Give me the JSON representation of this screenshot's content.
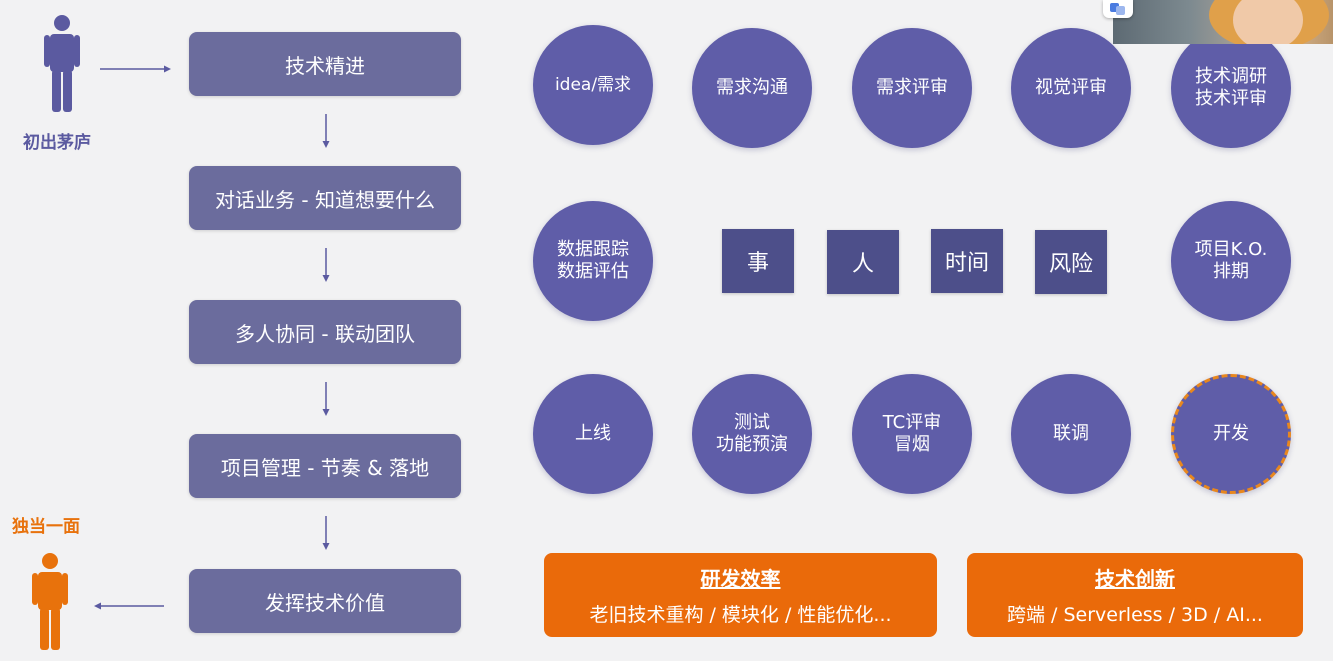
{
  "flow": {
    "steps": [
      "技术精进",
      "对话业务 - 知道想要什么",
      "多人协同 - 联动团队",
      "项目管理 - 节奏 & 落地",
      "发挥技术价值"
    ],
    "start_label": "初出茅庐",
    "end_label": "独当一面"
  },
  "circles": {
    "row1": [
      [
        "idea/需求"
      ],
      [
        "需求沟通"
      ],
      [
        "需求评审"
      ],
      [
        "视觉评审"
      ],
      [
        "技术调研",
        "技术评审"
      ]
    ],
    "row2_left": [
      "数据跟踪",
      "数据评估"
    ],
    "row2_right": [
      "项目K.O.",
      "排期"
    ],
    "row3": [
      [
        "上线"
      ],
      [
        "测试",
        "功能预演"
      ],
      [
        "TC评审",
        "冒烟"
      ],
      [
        "联调"
      ],
      [
        "开发"
      ]
    ]
  },
  "squares": [
    "事",
    "人",
    "时间",
    "风险"
  ],
  "bottom_boxes": [
    {
      "title": "研发效率",
      "subtitle": "老旧技术重构 / 模块化 / 性能优化..."
    },
    {
      "title": "技术创新",
      "subtitle": "跨端 / Serverless / 3D / AI..."
    }
  ],
  "colors": {
    "step_fill": "#6b6c9d",
    "circle_fill": "#5f5da8",
    "square_fill": "#4d4f8a",
    "orange": "#ea6a0a",
    "person_start": "#5b5aa0",
    "person_end": "#e8720c",
    "dashed_border": "#e8871e"
  },
  "icons": {
    "start_person": "person-icon",
    "end_person": "person-icon",
    "webcam": "webcam-overlay",
    "translate_badge": "translate-icon"
  }
}
